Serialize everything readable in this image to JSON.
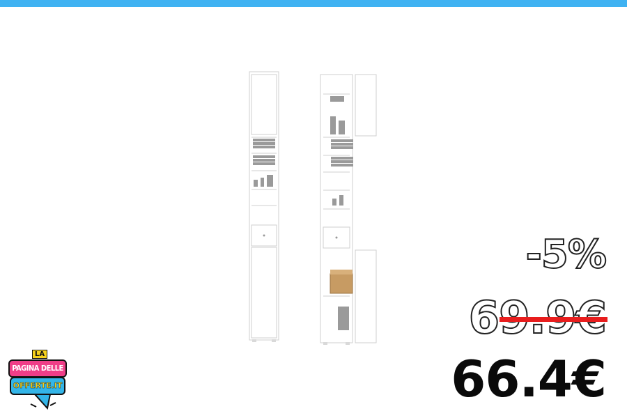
{
  "colors": {
    "top_bar": "#3fb2f2",
    "strike": "#e81d1d",
    "logo_pink": "#ef3e88",
    "logo_blue": "#33b5e8",
    "logo_yellow": "#f7d21c"
  },
  "offer": {
    "discount": "-5%",
    "old_price": "69.9€",
    "new_price": "66.4€"
  },
  "logo": {
    "la": "LA",
    "line1": "PAGINA DELLE",
    "line2": "OFFERTE.IT"
  }
}
